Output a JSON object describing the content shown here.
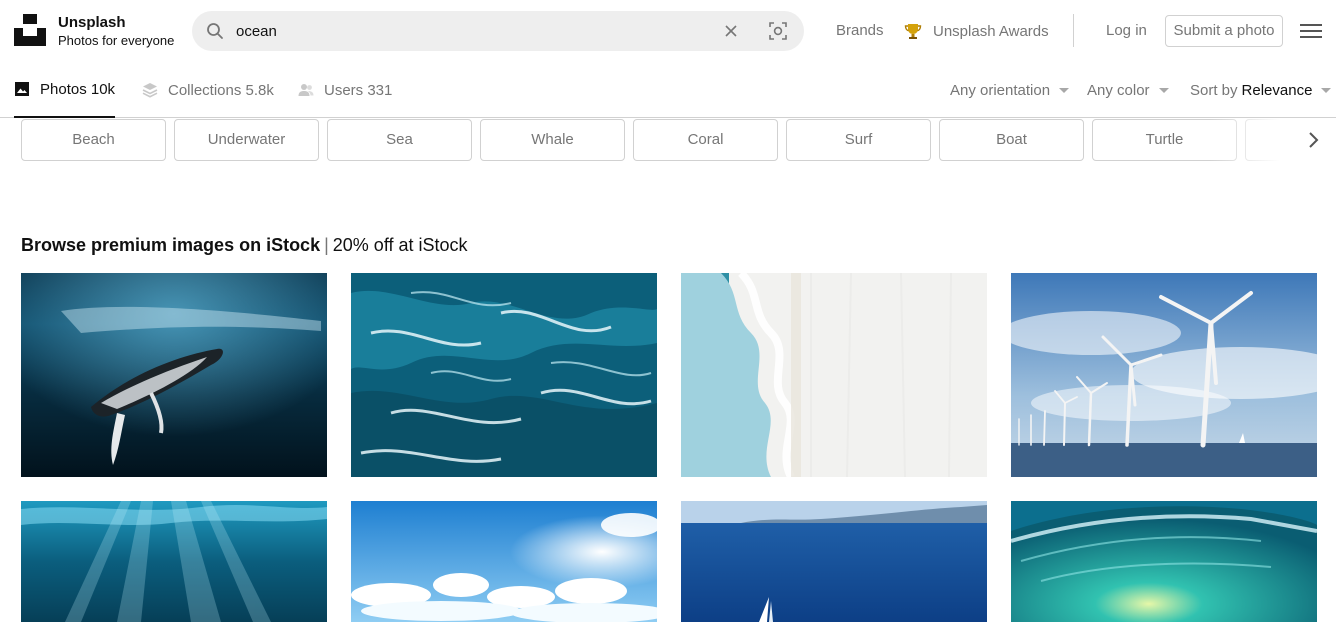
{
  "header": {
    "brand_name": "Unsplash",
    "brand_tagline": "Photos for everyone",
    "search": {
      "value": "ocean",
      "icon": "search-icon",
      "clear_icon": "close-icon",
      "visual_search_icon": "visual-search-icon"
    },
    "nav": {
      "brands": "Brands",
      "awards": "Unsplash Awards",
      "login": "Log in",
      "submit": "Submit a photo"
    },
    "menu_icon": "hamburger-menu-icon"
  },
  "tabs": [
    {
      "label": "Photos",
      "count": "10k",
      "icon": "photo-icon",
      "active": true
    },
    {
      "label": "Collections",
      "count": "5.8k",
      "icon": "collections-icon",
      "active": false
    },
    {
      "label": "Users",
      "count": "331",
      "icon": "users-icon",
      "active": false
    }
  ],
  "tab_labels": {
    "photos": "Photos 10k",
    "collections": "Collections 5.8k",
    "users": "Users 331"
  },
  "filters": {
    "orientation": "Any orientation",
    "color": "Any color",
    "sort_prefix": "Sort by",
    "sort_value": "Relevance"
  },
  "related_searches": [
    "Beach",
    "Underwater",
    "Sea",
    "Whale",
    "Coral",
    "Surf",
    "Boat",
    "Turtle"
  ],
  "istock": {
    "heading": "Browse premium images on iStock",
    "offer": "20% off at iStock"
  },
  "colors": {
    "accent_text": "#111111",
    "muted_text": "#767676",
    "border": "#d1d1d1",
    "search_bg": "#eeeeee"
  },
  "images": [
    {
      "subject": "humpback whale underwater"
    },
    {
      "subject": "aerial ocean waves"
    },
    {
      "subject": "aerial beach shoreline"
    },
    {
      "subject": "offshore wind turbines"
    },
    {
      "subject": "underwater sun rays"
    },
    {
      "subject": "bright sky with clouds"
    },
    {
      "subject": "blue sea with sailboat"
    },
    {
      "subject": "curling wave from inside"
    }
  ]
}
